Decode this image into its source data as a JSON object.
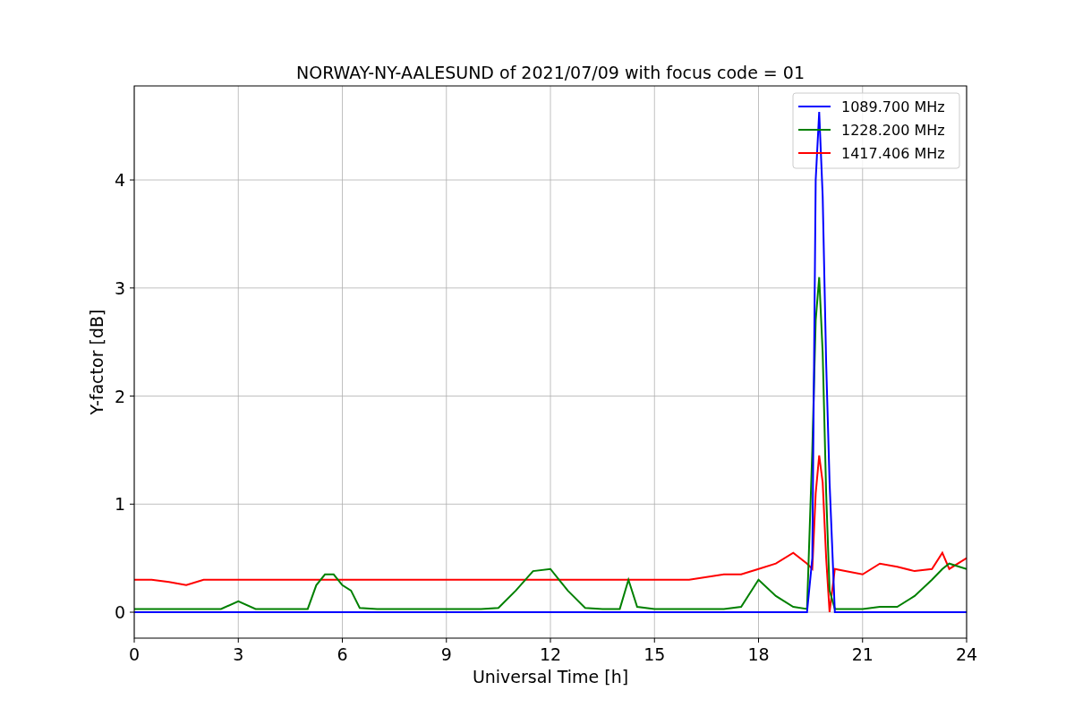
{
  "figure": {
    "chart_data": {
      "type": "line",
      "title": "NORWAY-NY-AALESUND of 2021/07/09 with focus code = 01",
      "xlabel": "Universal Time [h]",
      "ylabel": "Y-factor [dB]",
      "x": [
        0,
        0.5,
        1,
        1.5,
        2,
        2.5,
        3,
        3.5,
        4,
        4.5,
        5,
        5.25,
        5.5,
        5.75,
        6,
        6.25,
        6.5,
        7,
        8,
        9,
        10,
        10.5,
        11,
        11.5,
        12,
        12.25,
        12.5,
        13,
        13.5,
        14,
        14.25,
        14.5,
        15,
        16,
        17,
        17.5,
        18,
        18.5,
        19,
        19.4,
        19.55,
        19.65,
        19.75,
        19.85,
        19.95,
        20.05,
        20.2,
        20.5,
        21,
        21.5,
        22,
        22.5,
        23,
        23.3,
        23.5,
        24
      ],
      "series": [
        {
          "name": "1089.700 MHz",
          "color": "#0000ff",
          "values": [
            0,
            0,
            0,
            0,
            0,
            0,
            0,
            0,
            0,
            0,
            0,
            0,
            0,
            0,
            0,
            0,
            0,
            0,
            0,
            0,
            0,
            0,
            0,
            0,
            0,
            0,
            0,
            0,
            0,
            0,
            0,
            0,
            0,
            0,
            0,
            0,
            0,
            0,
            0,
            0,
            0.5,
            4.0,
            4.63,
            3.85,
            2.3,
            1.2,
            0,
            0,
            0,
            0,
            0,
            0,
            0,
            0,
            0,
            0
          ]
        },
        {
          "name": "1228.200 MHz",
          "color": "#008000",
          "values": [
            0.03,
            0.03,
            0.03,
            0.03,
            0.03,
            0.03,
            0.1,
            0.03,
            0.03,
            0.03,
            0.03,
            0.25,
            0.35,
            0.35,
            0.25,
            0.2,
            0.04,
            0.03,
            0.03,
            0.03,
            0.03,
            0.04,
            0.2,
            0.38,
            0.4,
            0.3,
            0.2,
            0.04,
            0.03,
            0.03,
            0.3,
            0.05,
            0.03,
            0.03,
            0.03,
            0.05,
            0.3,
            0.15,
            0.05,
            0.03,
            1.5,
            2.7,
            3.1,
            2.4,
            1.1,
            0.2,
            0.03,
            0.03,
            0.03,
            0.05,
            0.05,
            0.15,
            0.3,
            0.4,
            0.45,
            0.4
          ]
        },
        {
          "name": "1417.406 MHz",
          "color": "#ff0000",
          "values": [
            0.3,
            0.3,
            0.28,
            0.25,
            0.3,
            0.3,
            0.3,
            0.3,
            0.3,
            0.3,
            0.3,
            0.3,
            0.3,
            0.3,
            0.3,
            0.3,
            0.3,
            0.3,
            0.3,
            0.3,
            0.3,
            0.3,
            0.3,
            0.3,
            0.3,
            0.3,
            0.3,
            0.3,
            0.3,
            0.3,
            0.3,
            0.3,
            0.3,
            0.3,
            0.35,
            0.35,
            0.4,
            0.45,
            0.55,
            0.45,
            0.4,
            1.1,
            1.45,
            1.2,
            0.5,
            0.0,
            0.4,
            0.38,
            0.35,
            0.45,
            0.42,
            0.38,
            0.4,
            0.55,
            0.4,
            0.5
          ]
        }
      ],
      "xlim": [
        0,
        24
      ],
      "ylim": [
        -0.24,
        4.87
      ],
      "xticks": [
        0,
        3,
        6,
        9,
        12,
        15,
        18,
        21,
        24
      ],
      "yticks": [
        0,
        1,
        2,
        3,
        4
      ],
      "grid": true,
      "legend": true
    }
  }
}
